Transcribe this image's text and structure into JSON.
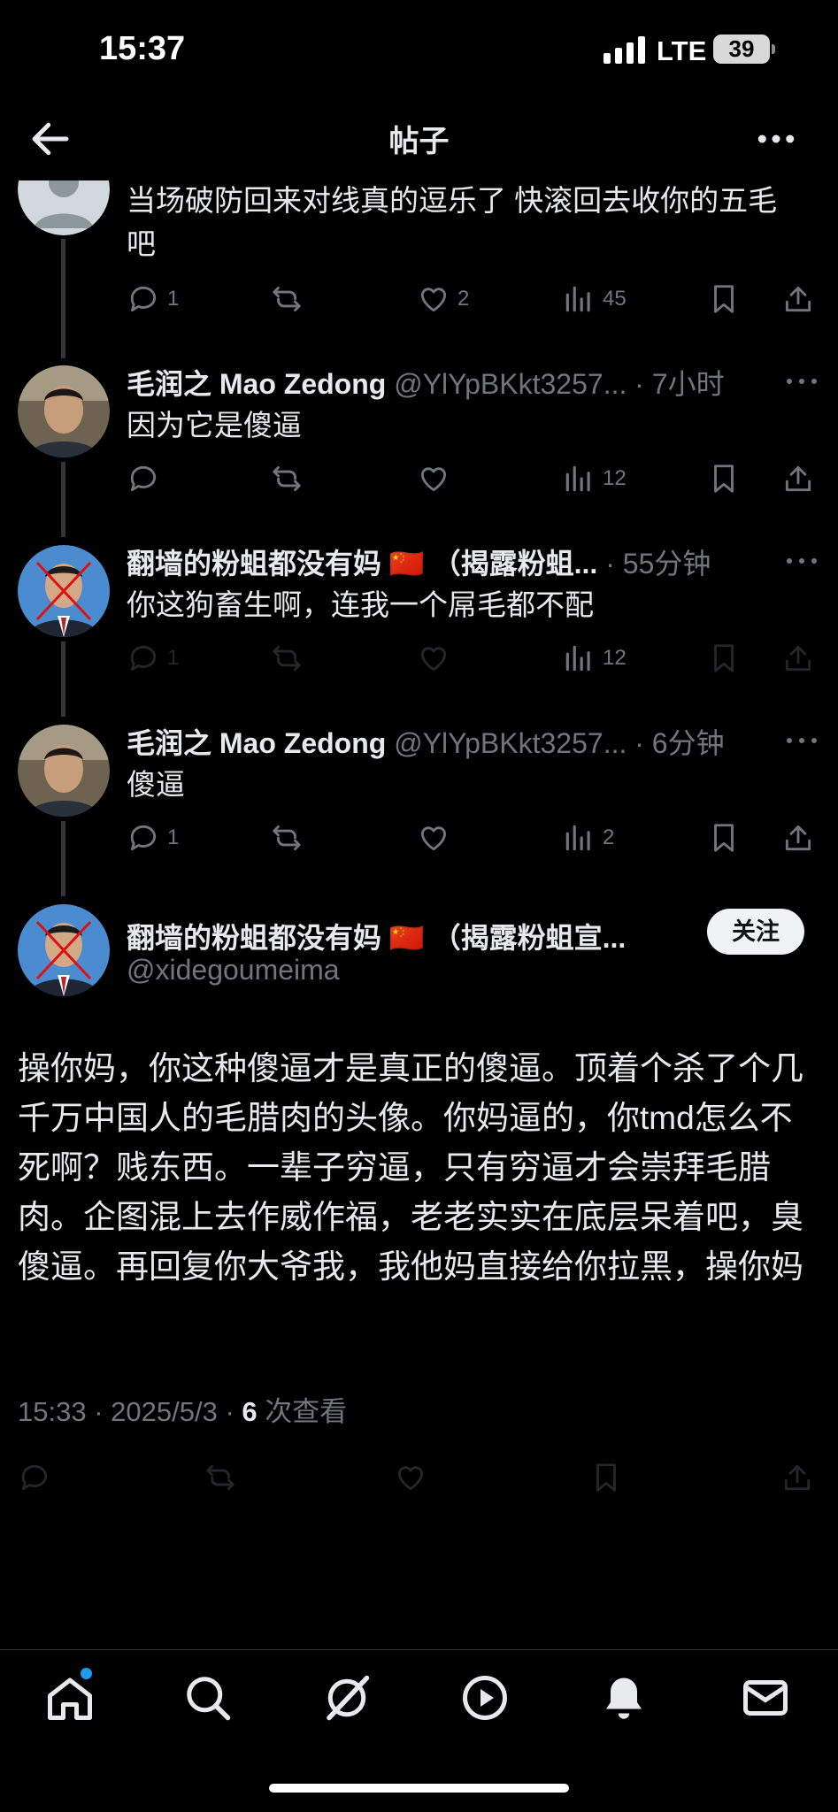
{
  "status_bar": {
    "time": "15:37",
    "network": "LTE",
    "battery": "39"
  },
  "header": {
    "title": "帖子"
  },
  "replies": [
    {
      "text": "当场破防回来对线真的逗乐了   快滚回去收你的五毛吧",
      "actions": {
        "reply": "1",
        "repost": "",
        "like": "2",
        "views": "45"
      },
      "dimmed": false
    },
    {
      "name": "毛润之 Mao Zedong",
      "handle": "@YlYpBKkt3257...",
      "dot": "·",
      "time": "7小时",
      "text": "因为它是傻逼",
      "actions": {
        "reply": "",
        "repost": "",
        "like": "",
        "views": "12"
      },
      "dimmed": false
    },
    {
      "name": "翻墙的粉蛆都没有妈",
      "flag": "🇨🇳",
      "name_suffix": "（揭露粉蛆...",
      "dot": "·",
      "time": "55分钟",
      "text": "你这狗畜生啊，连我一个屌毛都不配",
      "actions": {
        "reply": "1",
        "repost": "",
        "like": "",
        "views": "12"
      },
      "dimmed": true
    },
    {
      "name": "毛润之 Mao Zedong",
      "handle": "@YlYpBKkt3257...",
      "dot": "·",
      "time": "6分钟",
      "text": "傻逼",
      "actions": {
        "reply": "1",
        "repost": "",
        "like": "",
        "views": "2"
      },
      "dimmed": false
    }
  ],
  "main_post": {
    "name": "翻墙的粉蛆都没有妈",
    "flag": "🇨🇳",
    "name_suffix": "（揭露粉蛆宣...",
    "handle": "@xidegoumeima",
    "follow_label": "关注",
    "text": "操你妈，你这种傻逼才是真正的傻逼。顶着个杀了个几千万中国人的毛腊肉的头像。你妈逼的，你tmd怎么不死啊？贱东西。一辈子穷逼，只有穷逼才会崇拜毛腊肉。企图混上去作威作福，老老实实在底层呆着吧，臭傻逼。再回复你大爷我，我他妈直接给你拉黑，操你妈",
    "time": "15:33",
    "date": "2025/5/3",
    "views_count": "6",
    "views_label": "次查看",
    "sep": "·"
  },
  "tabbar": {
    "items": [
      "home-icon",
      "search-icon",
      "grok-icon",
      "video-icon",
      "notifications-icon",
      "messages-icon"
    ]
  },
  "colors": {
    "background": "#000000",
    "text": "#e7e9ea",
    "secondary": "#71767b",
    "accent": "#1d9bf0"
  }
}
